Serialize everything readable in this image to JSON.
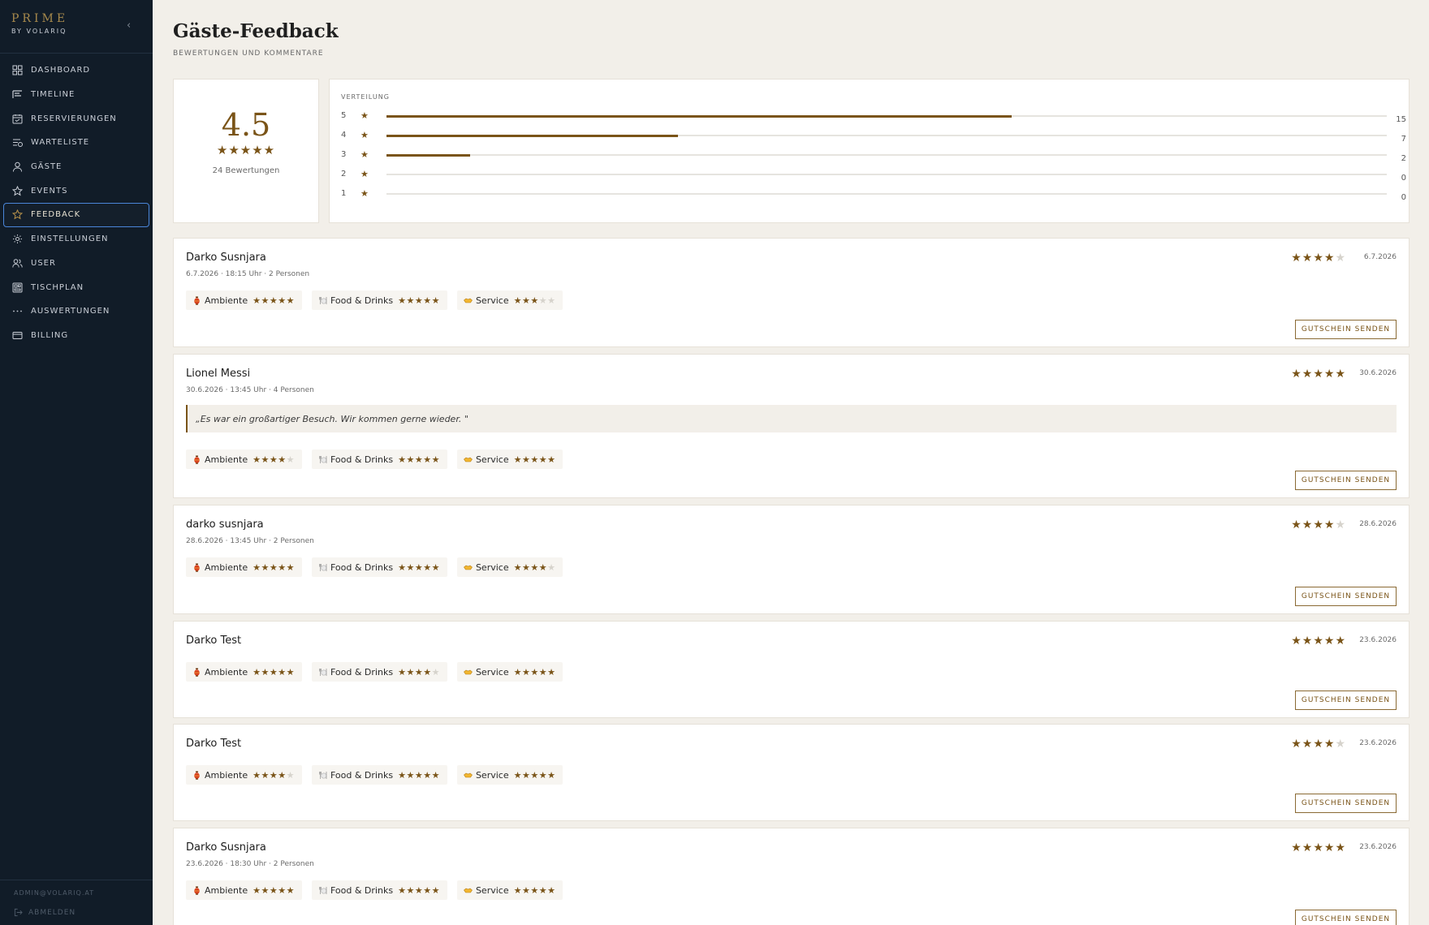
{
  "brand": {
    "title": "PRIME",
    "subtitle": "BY VOLARIQ",
    "collapse_icon": "chevron-left-icon"
  },
  "nav": [
    {
      "label": "DASHBOARD",
      "icon": "grid-icon",
      "active": false
    },
    {
      "label": "TIMELINE",
      "icon": "timeline-icon",
      "active": false
    },
    {
      "label": "RESERVIERUNGEN",
      "icon": "calendar-icon",
      "active": false
    },
    {
      "label": "WARTELISTE",
      "icon": "waitlist-icon",
      "active": false
    },
    {
      "label": "GÄSTE",
      "icon": "person-icon",
      "active": false
    },
    {
      "label": "EVENTS",
      "icon": "star-icon",
      "active": false
    },
    {
      "label": "FEEDBACK",
      "icon": "star-icon",
      "active": true
    },
    {
      "label": "EINSTELLUNGEN",
      "icon": "gear-icon",
      "active": false
    },
    {
      "label": "USER",
      "icon": "users-icon",
      "active": false
    },
    {
      "label": "TISCHPLAN",
      "icon": "table-plan-icon",
      "active": false
    },
    {
      "label": "AUSWERTUNGEN",
      "icon": "dots-icon",
      "active": false
    },
    {
      "label": "BILLING",
      "icon": "card-icon",
      "active": false
    }
  ],
  "footer": {
    "email": "ADMIN@VOLARIQ.AT",
    "logout": "ABMELDEN"
  },
  "header": {
    "title": "Gäste-Feedback",
    "subtitle": "BEWERTUNGEN UND KOMMENTARE"
  },
  "summary": {
    "average": "4.5",
    "stars": "★★★★★",
    "count_label": "24 Bewertungen"
  },
  "distribution": {
    "title": "VERTEILUNG",
    "rows": [
      {
        "label": "5",
        "star": "★",
        "count": "15",
        "value": 15
      },
      {
        "label": "4",
        "star": "★",
        "count": "7",
        "value": 7
      },
      {
        "label": "3",
        "star": "★",
        "count": "2",
        "value": 2
      },
      {
        "label": "2",
        "star": "★",
        "count": "0",
        "value": 0
      },
      {
        "label": "1",
        "star": "★",
        "count": "0",
        "value": 0
      }
    ],
    "max": 24
  },
  "colors": {
    "accent": "#7a5418",
    "sidebar": "#111c28",
    "background": "#f2efe9"
  },
  "reviews": [
    {
      "name": "Darko Susnjara",
      "meta": "6.7.2026 · 18:15 Uhr · 2 Personen",
      "overall": 4,
      "date": "6.7.2026",
      "comment": "",
      "categories": [
        {
          "label": "Ambiente",
          "icon": "lantern-icon",
          "rating": 5
        },
        {
          "label": "Food & Drinks",
          "icon": "plate-icon",
          "rating": 5
        },
        {
          "label": "Service",
          "icon": "handshake-icon",
          "rating": 3
        }
      ],
      "button": "GUTSCHEIN SENDEN"
    },
    {
      "name": "Lionel Messi",
      "meta": "30.6.2026 · 13:45 Uhr · 4 Personen",
      "overall": 5,
      "date": "30.6.2026",
      "comment": "„Es war ein großartiger Besuch. Wir kommen gerne wieder. \"",
      "categories": [
        {
          "label": "Ambiente",
          "icon": "lantern-icon",
          "rating": 4
        },
        {
          "label": "Food & Drinks",
          "icon": "plate-icon",
          "rating": 5
        },
        {
          "label": "Service",
          "icon": "handshake-icon",
          "rating": 5
        }
      ],
      "button": "GUTSCHEIN SENDEN"
    },
    {
      "name": "darko susnjara",
      "meta": "28.6.2026 · 13:45 Uhr · 2 Personen",
      "overall": 4,
      "date": "28.6.2026",
      "comment": "",
      "categories": [
        {
          "label": "Ambiente",
          "icon": "lantern-icon",
          "rating": 5
        },
        {
          "label": "Food & Drinks",
          "icon": "plate-icon",
          "rating": 5
        },
        {
          "label": "Service",
          "icon": "handshake-icon",
          "rating": 4
        }
      ],
      "button": "GUTSCHEIN SENDEN"
    },
    {
      "name": "Darko Test",
      "meta": "",
      "overall": 5,
      "date": "23.6.2026",
      "comment": "",
      "categories": [
        {
          "label": "Ambiente",
          "icon": "lantern-icon",
          "rating": 5
        },
        {
          "label": "Food & Drinks",
          "icon": "plate-icon",
          "rating": 4
        },
        {
          "label": "Service",
          "icon": "handshake-icon",
          "rating": 5
        }
      ],
      "button": "GUTSCHEIN SENDEN"
    },
    {
      "name": "Darko Test",
      "meta": "",
      "overall": 4,
      "date": "23.6.2026",
      "comment": "",
      "categories": [
        {
          "label": "Ambiente",
          "icon": "lantern-icon",
          "rating": 4
        },
        {
          "label": "Food & Drinks",
          "icon": "plate-icon",
          "rating": 5
        },
        {
          "label": "Service",
          "icon": "handshake-icon",
          "rating": 5
        }
      ],
      "button": "GUTSCHEIN SENDEN"
    },
    {
      "name": "Darko Susnjara",
      "meta": "23.6.2026 · 18:30 Uhr · 2 Personen",
      "overall": 5,
      "date": "23.6.2026",
      "comment": "",
      "categories": [
        {
          "label": "Ambiente",
          "icon": "lantern-icon",
          "rating": 5
        },
        {
          "label": "Food & Drinks",
          "icon": "plate-icon",
          "rating": 5
        },
        {
          "label": "Service",
          "icon": "handshake-icon",
          "rating": 5
        }
      ],
      "button": "GUTSCHEIN SENDEN"
    }
  ]
}
